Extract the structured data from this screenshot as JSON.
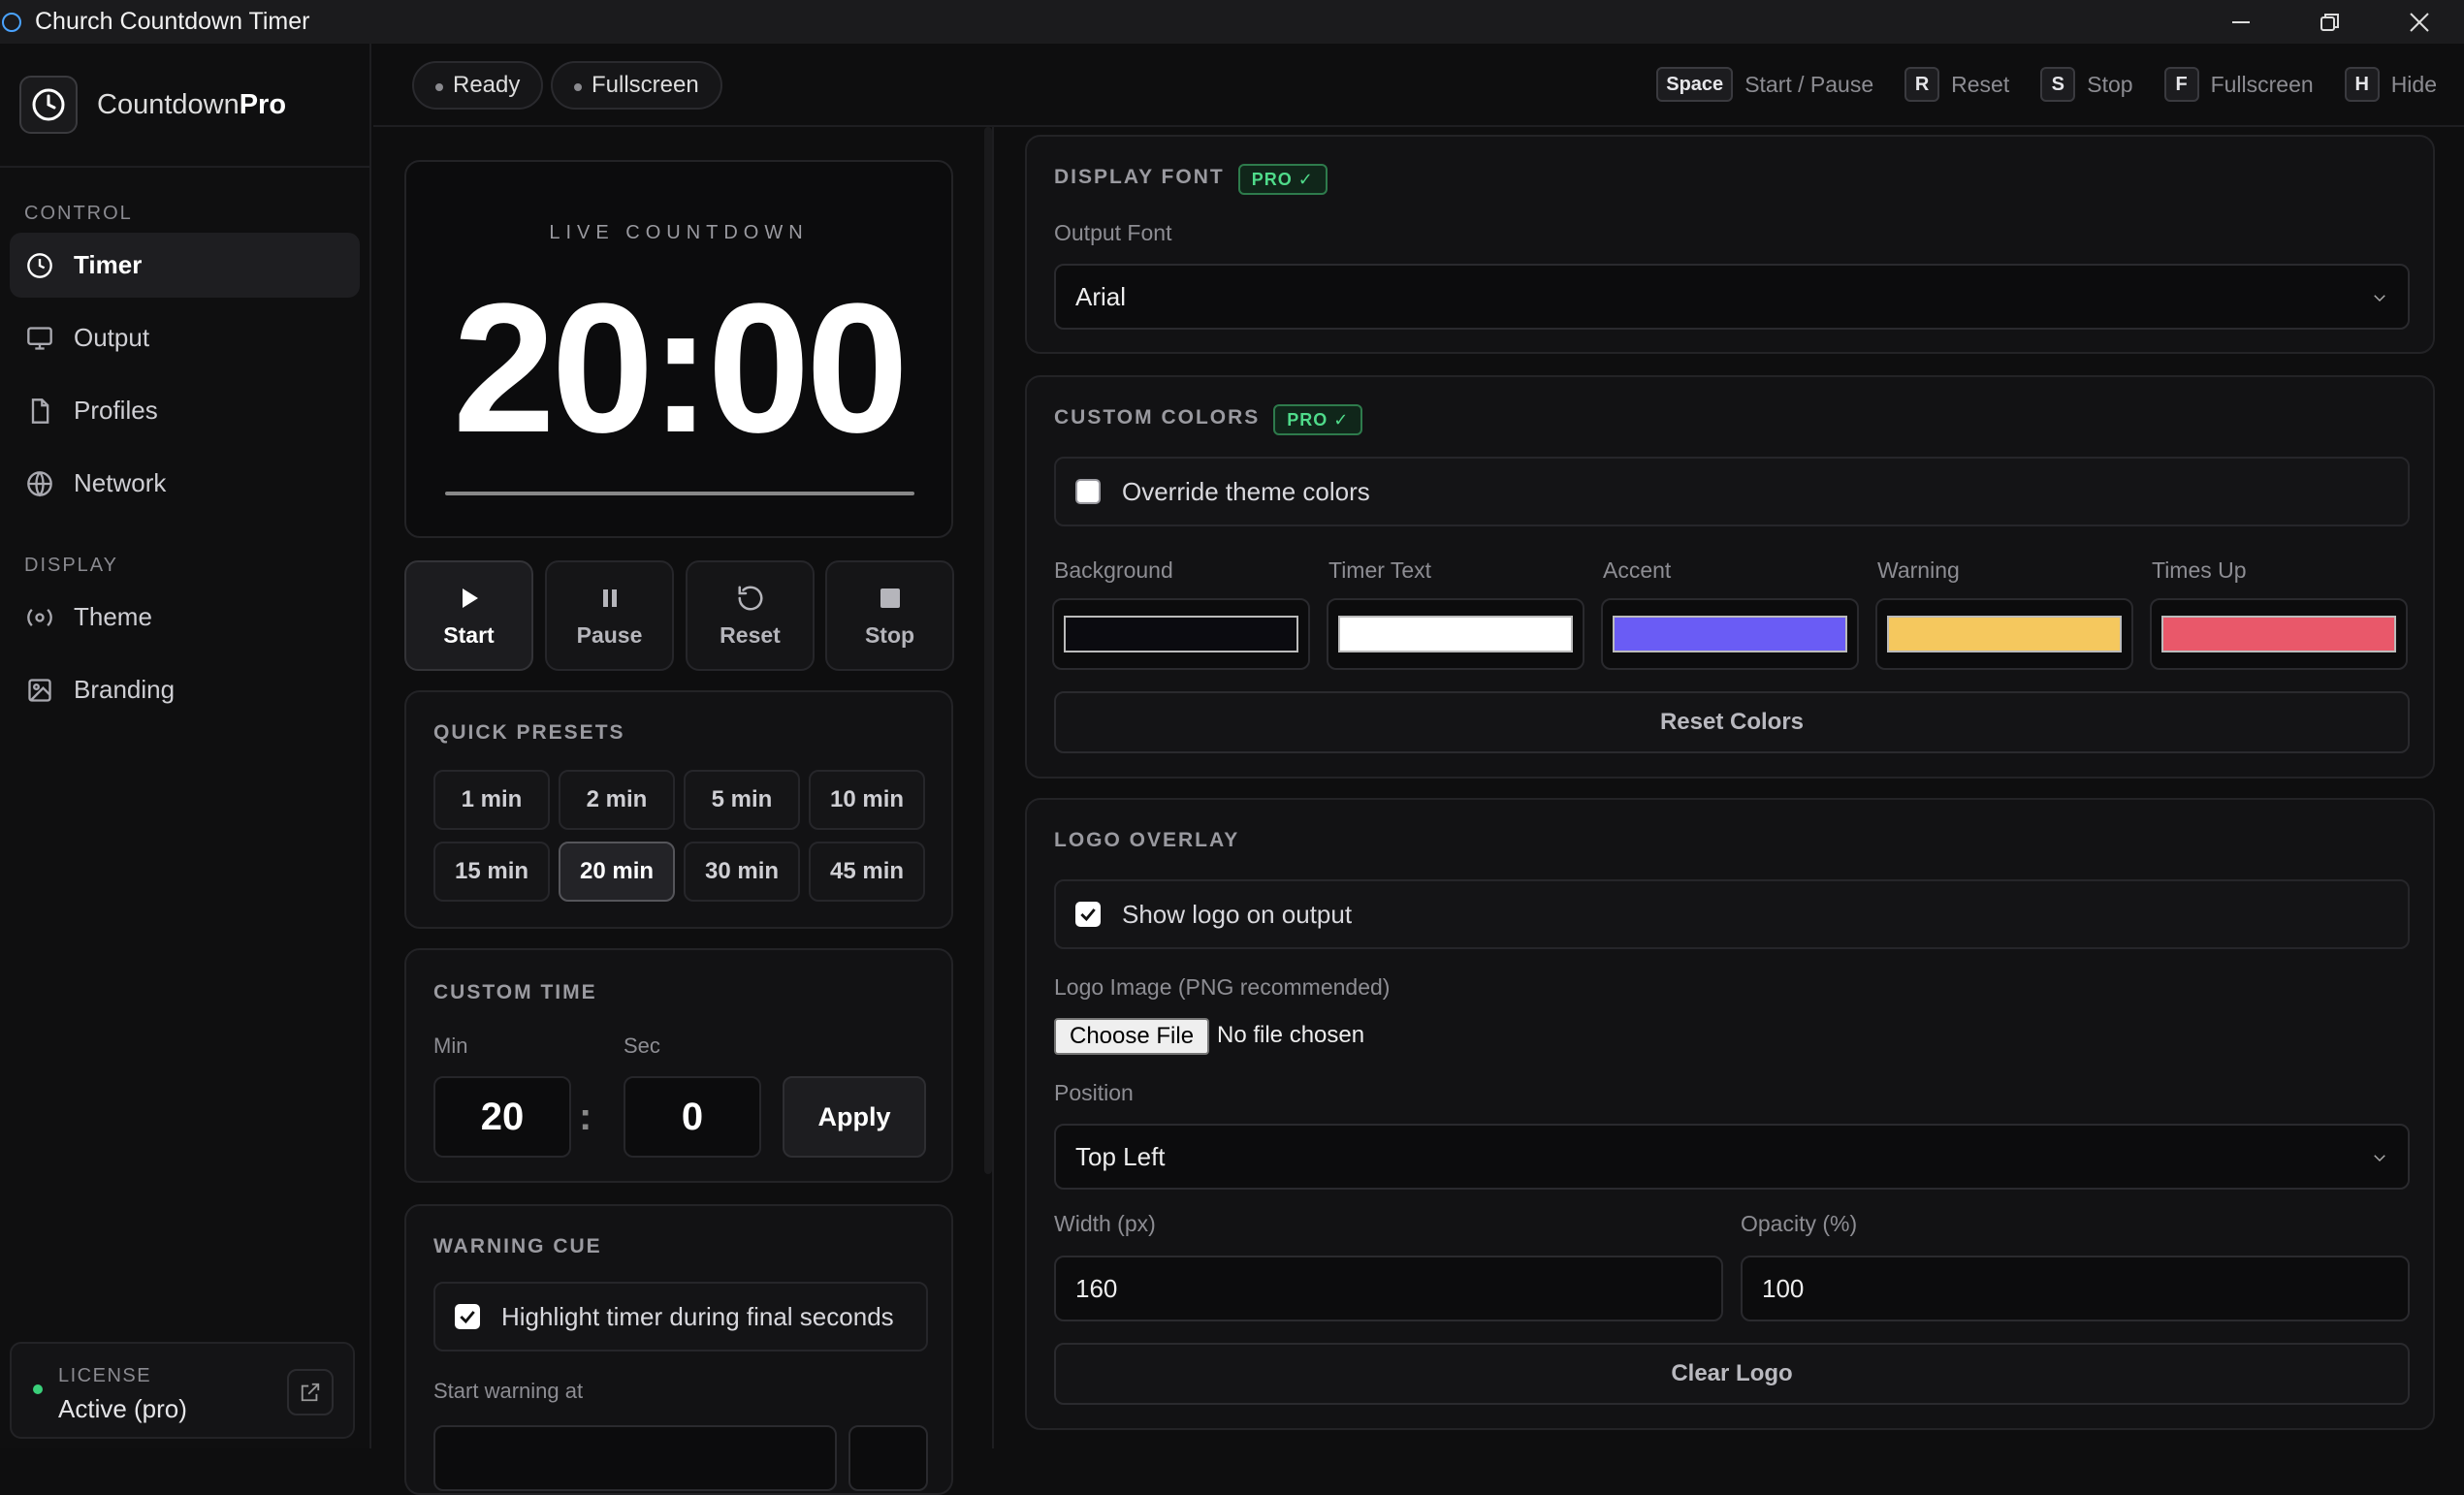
{
  "window": {
    "title": "Church Countdown Timer"
  },
  "brand": {
    "prefix": "Countdown",
    "suffix": "Pro"
  },
  "sidebar": {
    "control_label": "CONTROL",
    "display_label": "DISPLAY",
    "control_items": [
      {
        "label": "Timer",
        "icon": "clock-icon",
        "active": true
      },
      {
        "label": "Output",
        "icon": "monitor-icon"
      },
      {
        "label": "Profiles",
        "icon": "file-icon"
      },
      {
        "label": "Network",
        "icon": "globe-icon"
      }
    ],
    "display_items": [
      {
        "label": "Theme",
        "icon": "theme-icon"
      },
      {
        "label": "Branding",
        "icon": "image-icon"
      }
    ],
    "license": {
      "label": "LICENSE",
      "value": "Active (pro)"
    }
  },
  "topbar": {
    "status_pill": "Ready",
    "fullscreen_pill": "Fullscreen",
    "shortcuts": [
      {
        "key": "Space",
        "label": "Start / Pause"
      },
      {
        "key": "R",
        "label": "Reset"
      },
      {
        "key": "S",
        "label": "Stop"
      },
      {
        "key": "F",
        "label": "Fullscreen"
      },
      {
        "key": "H",
        "label": "Hide"
      }
    ]
  },
  "timer": {
    "live_label": "LIVE COUNTDOWN",
    "time": "20:00",
    "controls": [
      {
        "label": "Start",
        "icon": "play-icon"
      },
      {
        "label": "Pause",
        "icon": "pause-icon"
      },
      {
        "label": "Reset",
        "icon": "reset-icon"
      },
      {
        "label": "Stop",
        "icon": "stop-icon"
      }
    ]
  },
  "presets": {
    "title": "QUICK PRESETS",
    "items": [
      "1 min",
      "2 min",
      "5 min",
      "10 min",
      "15 min",
      "20 min",
      "30 min",
      "45 min"
    ],
    "active": "20 min"
  },
  "custom_time": {
    "title": "CUSTOM TIME",
    "min_label": "Min",
    "sec_label": "Sec",
    "min_value": "20",
    "sec_value": "0",
    "separator": ":",
    "apply_label": "Apply"
  },
  "warning_cue": {
    "title": "WARNING CUE",
    "checkbox_label": "Highlight timer during final seconds",
    "checked": true,
    "start_label": "Start warning at"
  },
  "display_font": {
    "title": "DISPLAY FONT",
    "badge": "PRO ✓",
    "field_label": "Output Font",
    "value": "Arial"
  },
  "custom_colors": {
    "title": "CUSTOM COLORS",
    "badge": "PRO ✓",
    "override_label": "Override theme colors",
    "override_checked": false,
    "swatches": [
      {
        "label": "Background",
        "color": "#0b0b10"
      },
      {
        "label": "Timer Text",
        "color": "#ffffff"
      },
      {
        "label": "Accent",
        "color": "#6a5cf5"
      },
      {
        "label": "Warning",
        "color": "#f5c85e"
      },
      {
        "label": "Times Up",
        "color": "#e9586a"
      }
    ],
    "reset_label": "Reset Colors"
  },
  "logo_overlay": {
    "title": "LOGO OVERLAY",
    "show_label": "Show logo on output",
    "show_checked": true,
    "image_label": "Logo Image (PNG recommended)",
    "choose_label": "Choose File",
    "file_status": "No file chosen",
    "position_label": "Position",
    "position_value": "Top Left",
    "width_label": "Width (px)",
    "width_value": "160",
    "opacity_label": "Opacity (%)",
    "opacity_value": "100",
    "clear_label": "Clear Logo"
  }
}
